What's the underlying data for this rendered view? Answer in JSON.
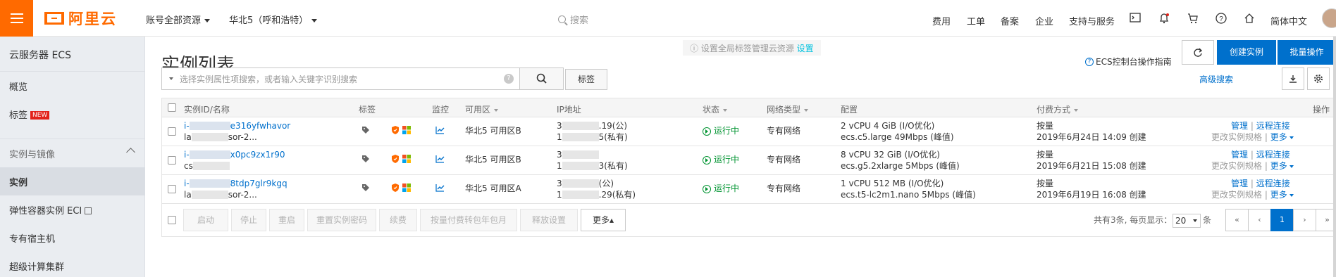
{
  "topbar": {
    "logo_text": "阿里云",
    "account_scope": "账号全部资源",
    "region": "华北5（呼和浩特）",
    "search_placeholder": "搜索",
    "links": [
      "费用",
      "工单",
      "备案",
      "企业",
      "支持与服务"
    ],
    "language": "简体中文",
    "icons": [
      "terminal-icon",
      "bell-icon",
      "cart-icon",
      "help-icon",
      "home-icon"
    ]
  },
  "sidebar": {
    "title": "云服务器 ECS",
    "items": [
      {
        "label": "概览"
      },
      {
        "label": "标签",
        "badge": "NEW"
      },
      {
        "label": "实例与镜像",
        "group": true
      },
      {
        "label": "实例",
        "active": true
      },
      {
        "label": "弹性容器实例 ECI"
      },
      {
        "label": "专有宿主机"
      },
      {
        "label": "超级计算集群"
      }
    ]
  },
  "main": {
    "tip_text": "设置全局标签管理云资源",
    "tip_link": "设置",
    "title": "实例列表",
    "guide": "ECS控制台操作指南",
    "create_btn": "创建实例",
    "batch_btn": "批量操作",
    "search_placeholder": "选择实例属性项搜索，或者输入关键字识别搜索",
    "tag_btn": "标签",
    "advanced_search": "高级搜索"
  },
  "table": {
    "headers": {
      "id": "实例ID/名称",
      "tag": "标签",
      "monitor": "监控",
      "zone": "可用区",
      "ip": "IP地址",
      "status": "状态",
      "network": "网络类型",
      "config": "配置",
      "billing": "付费方式",
      "ops": "操作"
    },
    "rows": [
      {
        "id_prefix": "i-",
        "id_suffix": "e316yfwhavor",
        "name_prefix": "la",
        "name_suffix": "sor-2...",
        "zone": "华北5 可用区B",
        "ip1_prefix": "3",
        "ip1_suffix": ".19(公)",
        "ip2_prefix": "1",
        "ip2_suffix": "5(私有)",
        "status": "运行中",
        "network": "专有网络",
        "config1": "2 vCPU 4 GiB (I/O优化)",
        "config2": "ecs.c5.large   49Mbps (峰值)",
        "billing1": "按量",
        "billing2": "2019年6月24日 14:09 创建",
        "op_manage": "管理",
        "op_remote": "远程连接",
        "op_change": "更改实例规格",
        "op_more": "更多"
      },
      {
        "id_prefix": "i-",
        "id_suffix": "x0pc9zx1r90",
        "name_prefix": "cs",
        "name_suffix": "",
        "zone": "华北5 可用区B",
        "ip1_prefix": "3",
        "ip1_suffix": "",
        "ip2_prefix": "1",
        "ip2_suffix": "3(私有)",
        "status": "运行中",
        "network": "专有网络",
        "config1": "8 vCPU 32 GiB (I/O优化)",
        "config2": "ecs.g5.2xlarge   5Mbps (峰值)",
        "billing1": "按量",
        "billing2": "2019年6月21日 15:08 创建",
        "op_manage": "管理",
        "op_remote": "远程连接",
        "op_change": "更改实例规格",
        "op_more": "更多"
      },
      {
        "id_prefix": "i-",
        "id_suffix": "8tdp7glr9kgq",
        "name_prefix": "la",
        "name_suffix": "sor-2...",
        "zone": "华北5 可用区A",
        "ip1_prefix": "3",
        "ip1_suffix": "(公)",
        "ip2_prefix": "1",
        "ip2_suffix": ".29(私有)",
        "status": "运行中",
        "network": "专有网络",
        "config1": "1 vCPU 512 MB (I/O优化)",
        "config2": "ecs.t5-lc2m1.nano   5Mbps (峰值)",
        "billing1": "按量",
        "billing2": "2019年6月19日 16:08 创建",
        "op_manage": "管理",
        "op_remote": "远程连接",
        "op_change": "更改实例规格",
        "op_more": "更多"
      }
    ]
  },
  "footer": {
    "buttons": [
      "启动",
      "停止",
      "重启",
      "重置实例密码",
      "续费",
      "按量付费转包年包月",
      "释放设置"
    ],
    "more": "更多▴",
    "total_text": "共有3条, 每页显示：",
    "page_size": "20",
    "page_size_unit": "条",
    "current_page": "1",
    "pager": {
      "first": "«",
      "prev": "‹",
      "next": "›",
      "last": "»"
    }
  },
  "colors": {
    "brand": "#ff6a00",
    "primary": "#0070cc",
    "running": "#009431"
  }
}
